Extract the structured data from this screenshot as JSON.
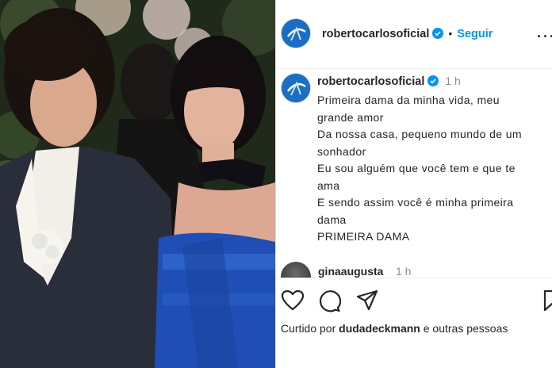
{
  "post": {
    "username": "robertocarlosoficial",
    "follow_label": "Seguir",
    "caption_time": "1 h",
    "caption_lines": [
      "Primeira dama da minha vida, meu",
      "grande amor",
      "Da nossa casa, pequeno mundo de um",
      "sonhador",
      "Eu sou alguém que você tem e que te",
      "ama",
      "E sendo assim você é minha primeira",
      "dama",
      "PRIMEIRA DAMA"
    ],
    "comment": {
      "username": "ginaaugusta",
      "time": "1 h"
    },
    "likes": {
      "prefix": "Curtido por",
      "user": "dudadeckmann",
      "suffix": "e outras pessoas"
    }
  },
  "colors": {
    "accent": "#0095f6",
    "avatar": "#1a6fc4",
    "text": "#262626",
    "muted": "#8e8e8e"
  },
  "icons": [
    "more-icon",
    "verified-icon",
    "heart-icon",
    "comment-icon",
    "share-icon",
    "bookmark-icon"
  ]
}
